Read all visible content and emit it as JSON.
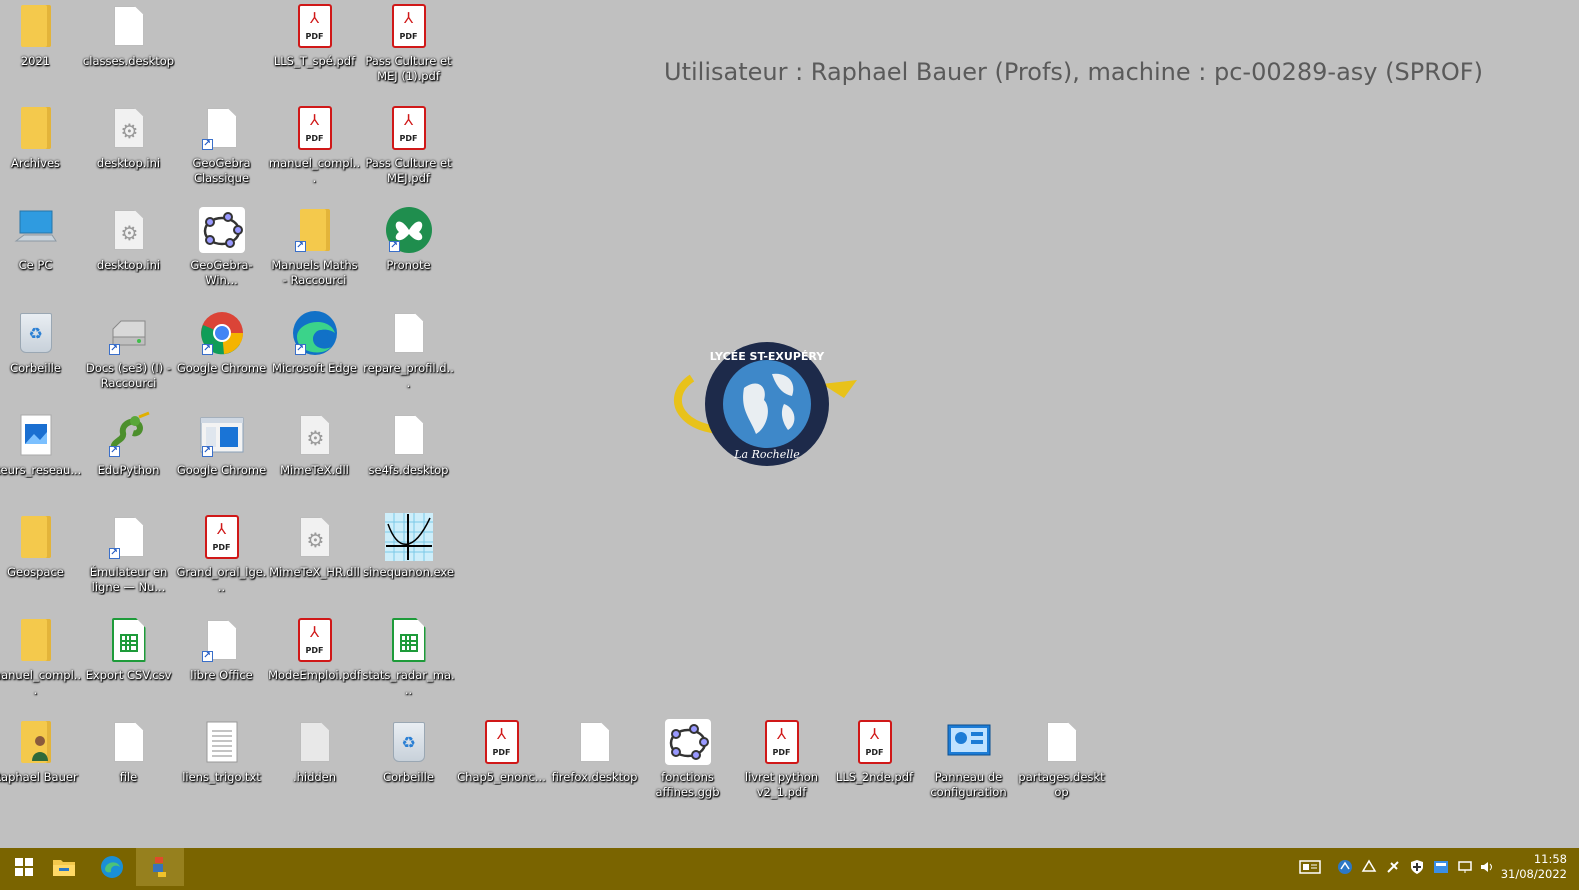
{
  "watermark": "Utilisateur : Raphael Bauer (Profs), machine : pc-00289-asy (SPROF)",
  "logo": {
    "top_text": "LYCÉE ST-EXUPÉRY",
    "bottom_text": "La Rochelle"
  },
  "icons": [
    {
      "label": "2021",
      "type": "folder"
    },
    {
      "label": "classes.desktop",
      "type": "doc"
    },
    {
      "label": "LLS_T_spé.pdf",
      "type": "pdf"
    },
    {
      "label": "Pass Culture et MEJ (1).pdf",
      "type": "pdf"
    },
    {
      "label": "Archives",
      "type": "folder"
    },
    {
      "label": "desktop.ini",
      "type": "ini"
    },
    {
      "label": "GeoGebra Classique",
      "type": "doc-shortcut"
    },
    {
      "label": "manuel_compl...",
      "type": "pdf"
    },
    {
      "label": "Pass Culture et MEJ.pdf",
      "type": "pdf"
    },
    {
      "label": "Ce PC",
      "type": "pc"
    },
    {
      "label": "desktop.ini",
      "type": "ini"
    },
    {
      "label": "GeoGebra-Win...",
      "type": "geogebra"
    },
    {
      "label": "Manuels Maths - Raccourci",
      "type": "folder-shortcut"
    },
    {
      "label": "Pronote",
      "type": "pronote"
    },
    {
      "label": "Corbeille",
      "type": "bin"
    },
    {
      "label": "Docs (se3) (I) - Raccourci",
      "type": "drive"
    },
    {
      "label": "Google Chrome",
      "type": "chrome"
    },
    {
      "label": "Microsoft Edge",
      "type": "edge"
    },
    {
      "label": "repare_profil.d...",
      "type": "doc"
    },
    {
      "label": "cteurs_reseau...",
      "type": "image"
    },
    {
      "label": "EduPython",
      "type": "python"
    },
    {
      "label": "Google Chrome",
      "type": "window-shortcut"
    },
    {
      "label": "MimeTeX.dll",
      "type": "ini"
    },
    {
      "label": "se4fs.desktop",
      "type": "doc"
    },
    {
      "label": "Geospace",
      "type": "folder"
    },
    {
      "label": "Émulateur en ligne — Nu...",
      "type": "doc-shortcut"
    },
    {
      "label": "Grand_oral_lge...",
      "type": "pdf"
    },
    {
      "label": "MimeTeX_HR.dll",
      "type": "ini"
    },
    {
      "label": "sinequanon.exe",
      "type": "graph"
    },
    {
      "label": "manuel_compl...",
      "type": "folder"
    },
    {
      "label": "Export CSV.csv",
      "type": "sheet"
    },
    {
      "label": "libre Office",
      "type": "doc-shortcut"
    },
    {
      "label": "ModeEmploi.pdf",
      "type": "pdf"
    },
    {
      "label": "stats_radar_ma...",
      "type": "sheet"
    },
    {
      "label": "Raphael Bauer",
      "type": "user-folder"
    },
    {
      "label": "file",
      "type": "doc"
    },
    {
      "label": "liens_trigo.txt",
      "type": "txt"
    },
    {
      "label": ".hidden",
      "type": "doc-grey"
    },
    {
      "label": "Corbeille",
      "type": "bin"
    },
    {
      "label": "Chap5_enonc...",
      "type": "pdf"
    },
    {
      "label": "firefox.desktop",
      "type": "doc"
    },
    {
      "label": "fonctions affines.ggb",
      "type": "geogebra"
    },
    {
      "label": "livret python v2_1.pdf",
      "type": "pdf"
    },
    {
      "label": "LLS_2nde.pdf",
      "type": "pdf"
    },
    {
      "label": "Panneau de configuration",
      "type": "control"
    },
    {
      "label": "partages.desktop",
      "type": "doc"
    }
  ],
  "taskbar": {
    "pinned": [
      "windows-start",
      "file-explorer",
      "microsoft-edge",
      "app-active"
    ],
    "tray": [
      "news",
      "edupython-tray",
      "drive-tray",
      "satellite-tray",
      "security-tray",
      "network-share",
      "network",
      "volume"
    ],
    "time": "11:58",
    "date": "31/08/2022"
  },
  "colors": {
    "desktop_bg": "#c0c0c0",
    "taskbar_bg": "#7a6400"
  }
}
